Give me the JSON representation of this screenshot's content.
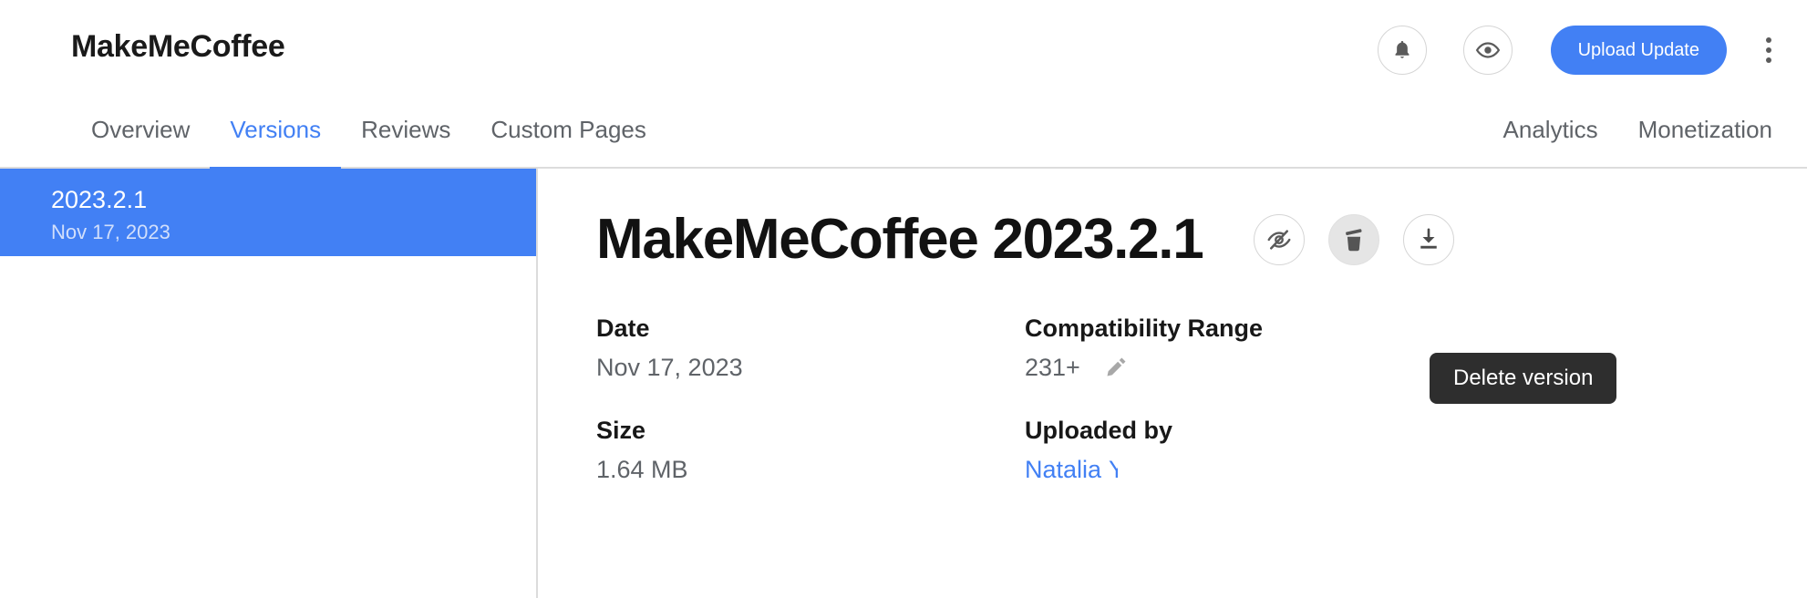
{
  "header": {
    "app_title": "MakeMeCoffee",
    "notifications_icon": "bell-icon",
    "preview_icon": "eye-icon",
    "upload_label": "Upload Update",
    "overflow_icon": "kebab-menu-icon"
  },
  "tabs": {
    "left": [
      {
        "label": "Overview",
        "active": false
      },
      {
        "label": "Versions",
        "active": true
      },
      {
        "label": "Reviews",
        "active": false
      },
      {
        "label": "Custom Pages",
        "active": false
      }
    ],
    "right": [
      {
        "label": "Analytics",
        "active": false
      },
      {
        "label": "Monetization",
        "active": false
      }
    ]
  },
  "sidebar": {
    "versions": [
      {
        "name": "2023.2.1",
        "date": "Nov 17, 2023",
        "selected": true
      }
    ]
  },
  "detail": {
    "title": "MakeMeCoffee 2023.2.1",
    "actions": [
      {
        "name": "hide-version-button",
        "icon": "eye-off-icon",
        "hovered": false
      },
      {
        "name": "delete-version-button",
        "icon": "trash-icon",
        "hovered": true
      },
      {
        "name": "download-version-button",
        "icon": "download-icon",
        "hovered": false
      }
    ],
    "tooltip": "Delete version",
    "fields": [
      [
        {
          "label": "Date",
          "value": "Nov 17, 2023",
          "link": false,
          "edit": false
        },
        {
          "label": "Compatibility Range",
          "value": "231+",
          "link": false,
          "edit": true
        }
      ],
      [
        {
          "label": "Size",
          "value": "1.64 MB",
          "link": false,
          "edit": false
        },
        {
          "label": "Uploaded by",
          "value": "Natalia",
          "link": true,
          "edit": false,
          "truncated": "Y"
        }
      ]
    ]
  },
  "colors": {
    "accent_blue": "#4280f4",
    "tooltip_bg": "#2e2e2e",
    "text_primary": "#181818",
    "text_secondary": "#5f6368",
    "border": "#dcdcdc"
  }
}
